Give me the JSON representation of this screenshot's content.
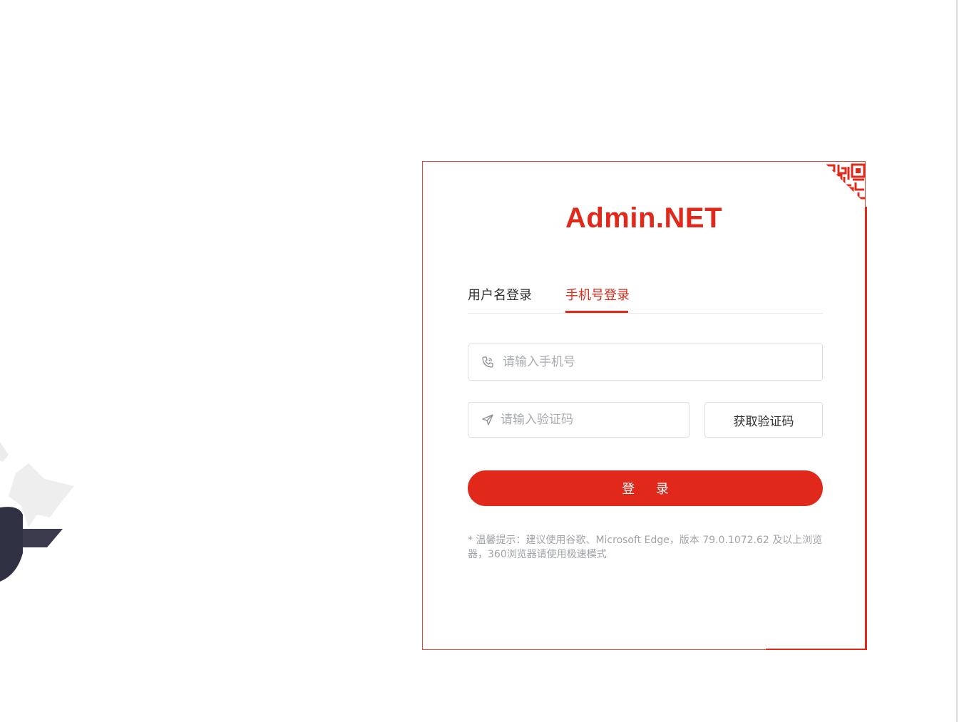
{
  "brand": {
    "title": "Admin.NET"
  },
  "tabs": [
    {
      "label": "用户名登录",
      "active": false
    },
    {
      "label": "手机号登录",
      "active": true
    }
  ],
  "form": {
    "phone_placeholder": "请输入手机号",
    "code_placeholder": "请输入验证码",
    "get_code_label": "获取验证码",
    "login_label": "登 录"
  },
  "tip": "* 温馨提示：建议使用谷歌、Microsoft Edge，版本 79.0.1072.62 及以上浏览器，360浏览器请使用极速模式",
  "icons": {
    "phone": "phone-icon",
    "code": "send-icon",
    "qr": "qr-code-icon"
  },
  "colors": {
    "accent": "#e0291a",
    "border": "#dcdfe6",
    "placeholder": "#a8abb2",
    "tip": "#a0a3a8",
    "text": "#303133"
  }
}
